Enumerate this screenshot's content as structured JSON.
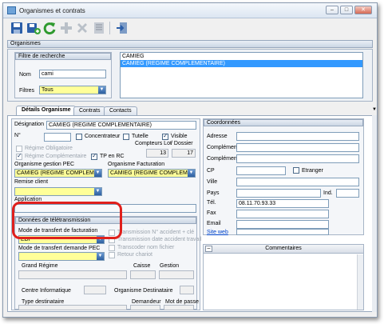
{
  "window": {
    "title": "Organismes et contrats",
    "min": "–",
    "max": "□",
    "close": "✕"
  },
  "colors": {
    "accent": "#3399ff",
    "highlight": "#e0201c",
    "yellow_field": "#ffff99"
  },
  "toolbar": {
    "icons": [
      "save-icon",
      "save-new-icon",
      "refresh-icon",
      "add-icon",
      "delete-icon",
      "list-icon",
      "exit-icon"
    ]
  },
  "organismes": {
    "header": "Organismes",
    "filtre_header": "Filtre de recherche",
    "nom_label": "Nom",
    "nom_value": "cami",
    "filtres_label": "Filtres",
    "filtres_value": "Tous",
    "results": [
      "CAMIEG",
      "CAMIEG (REGIME COMPLEMENTAIRE)"
    ]
  },
  "tabs": [
    "Détails Organisme",
    "Contrats",
    "Contacts"
  ],
  "details": {
    "designation_label": "Désignation",
    "designation_value": "CAMIEG (REGIME COMPLEMENTAIRE)",
    "numero_label": "N°",
    "concentrateur": "Concentrateur",
    "tutelle": "Tutelle",
    "visible": "Visible",
    "compteurs_label": "Compteurs Lot",
    "dossier_label": "/ Dossier",
    "compteur_lot": "13",
    "compteur_dossier": "17",
    "regime_obligatoire": "Régime Obligatoire",
    "regime_complementaire": "Régime Complémentaire",
    "tp_en_rc": "TP en RC",
    "gestion_pec_label": "Organisme gestion PEC",
    "gestion_pec_value": "CAMIEG (REGIME COMPLEMEN",
    "facturation_label": "Organisme Facturation",
    "facturation_value": "CAMIEG (REGIME COMPLEMEN",
    "remise_label": "Remise client",
    "application_label": "Application"
  },
  "teletransmission": {
    "header": "Données de télétransmission",
    "mode_fact_label": "Mode de transfert de facturation",
    "mode_fact_value": "EDI",
    "mode_demande_label": "Mode de transfert demande PEC",
    "opt1": "Transmission N° accident + clé",
    "opt2": "Transmission date accident travail",
    "opt3": "Transcoder nom fichier",
    "opt4": "Retour chariot",
    "grand_regime": "Grand Régime",
    "caisse": "Caisse",
    "gestion": "Gestion",
    "centre_info": "Centre Informatique",
    "org_dest": "Organisme Destinataire",
    "type_dest": "Type destinataire",
    "demandeur": "Demandeur",
    "mot_de_passe": "Mot de passe"
  },
  "coordonnees": {
    "header": "Coordonnées",
    "adresse": "Adresse",
    "complement": "Complément",
    "complement2": "Complément 2",
    "cp": "CP",
    "etranger": "Etranger",
    "ville": "Ville",
    "pays": "Pays",
    "ind": "Ind.",
    "tel": "Tél.",
    "tel_value": "08.11.70.93.33",
    "fax": "Fax",
    "email": "Email",
    "site_web": "Site web"
  },
  "commentaires": {
    "header": "Commentaires",
    "toggle": "–"
  }
}
